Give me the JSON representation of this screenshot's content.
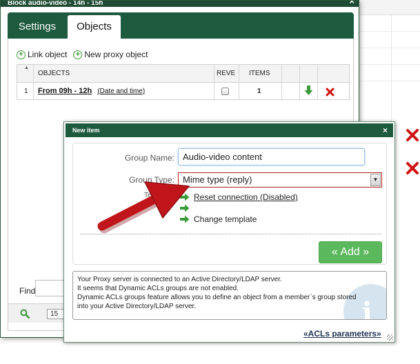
{
  "back_window": {
    "title": "Block audio-video - 14h - 15h",
    "tabs": [
      {
        "label": "Settings",
        "active": false
      },
      {
        "label": "Objects",
        "active": true
      }
    ],
    "toolbar": {
      "link_object_label": "Link object",
      "new_proxy_object_label": "New proxy object"
    },
    "grid": {
      "columns": [
        "",
        "OBJECTS",
        "REVE",
        "ITEMS",
        "",
        "",
        ""
      ],
      "rows": [
        {
          "num": "1",
          "name": "From 09h - 12h",
          "subtitle": "(Date and time)",
          "reverse": false,
          "items": "1"
        }
      ]
    },
    "find_label": "Find",
    "pager": {
      "page_size": "15"
    }
  },
  "dialog": {
    "title": "New item",
    "group_name_label": "Group Name:",
    "group_name_value": "Audio-video content",
    "group_type_label": "Group Type:",
    "group_type_value": "Mime type (reply)",
    "template_label": "Te",
    "options": [
      {
        "label": "Reset connection (Disabled)",
        "link": true
      },
      {
        "label": "",
        "link": false
      },
      {
        "label": "Change template",
        "link": false
      }
    ],
    "add_button_label": "« Add »",
    "info_lines": [
      "Your Proxy server is connected to an Active Directory/LDAP server.",
      "It seems that Dynamic ACLs groups are not enabled.",
      "Dynamic ACLs groups feature allows you to define an object from a member`s group stored",
      "into your Active Directory/LDAP server."
    ],
    "acl_link_label": "«ACLs parameters»"
  },
  "colors": {
    "titlebar_green": "#1d5a3e",
    "add_button_green": "#5cb85c",
    "delete_red": "#d01010",
    "arrow_green": "#3a9a3a",
    "callout_red": "#c0161b"
  }
}
